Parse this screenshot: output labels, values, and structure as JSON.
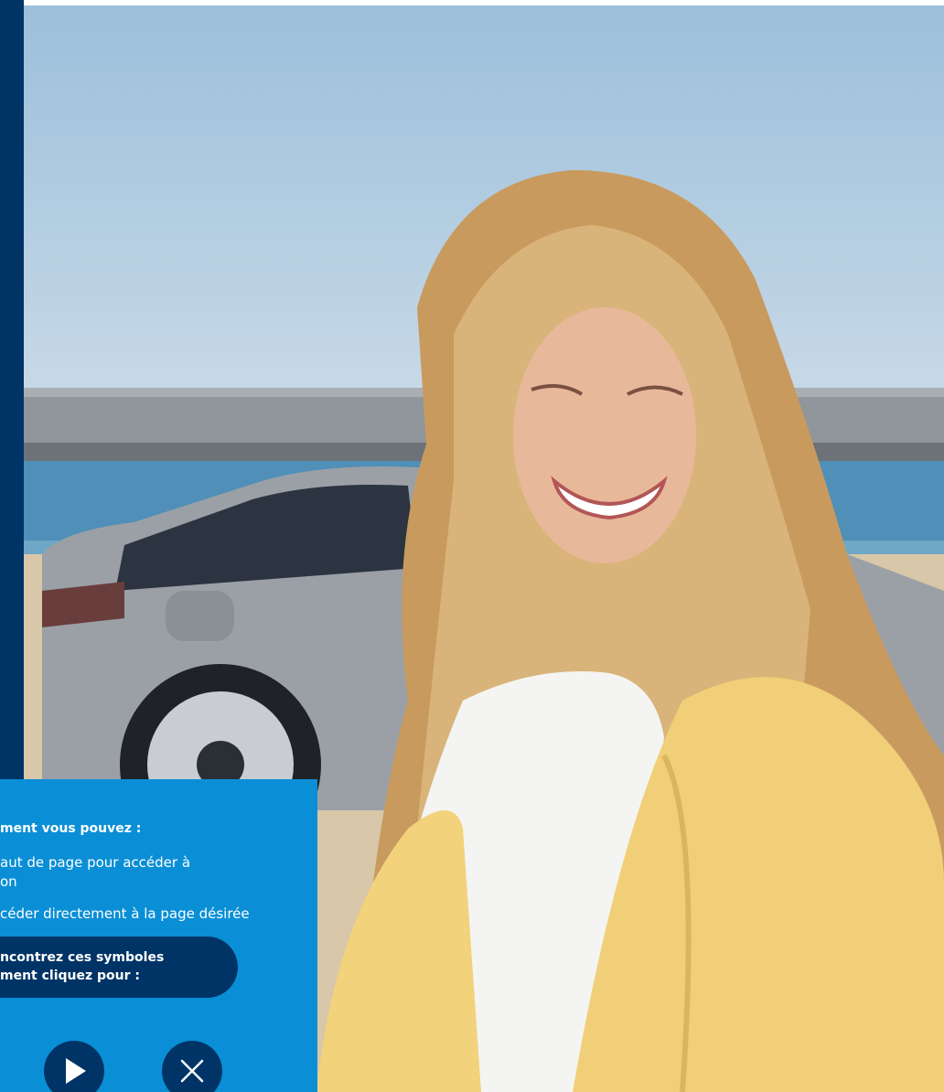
{
  "info_panel": {
    "heading": "ment vous pouvez :",
    "line1": "aut de page pour accéder à",
    "line2": "on",
    "line3": "céder directement à la page désirée",
    "symbols_line1": "ncontrez ces symboles",
    "symbols_line2": "ment cliquez pour :"
  },
  "icons": {
    "play": "play-icon",
    "close": "close-icon"
  },
  "colors": {
    "side_strip": "#003466",
    "panel": "#0a8fd6",
    "pill": "#003466",
    "button": "#003466"
  }
}
